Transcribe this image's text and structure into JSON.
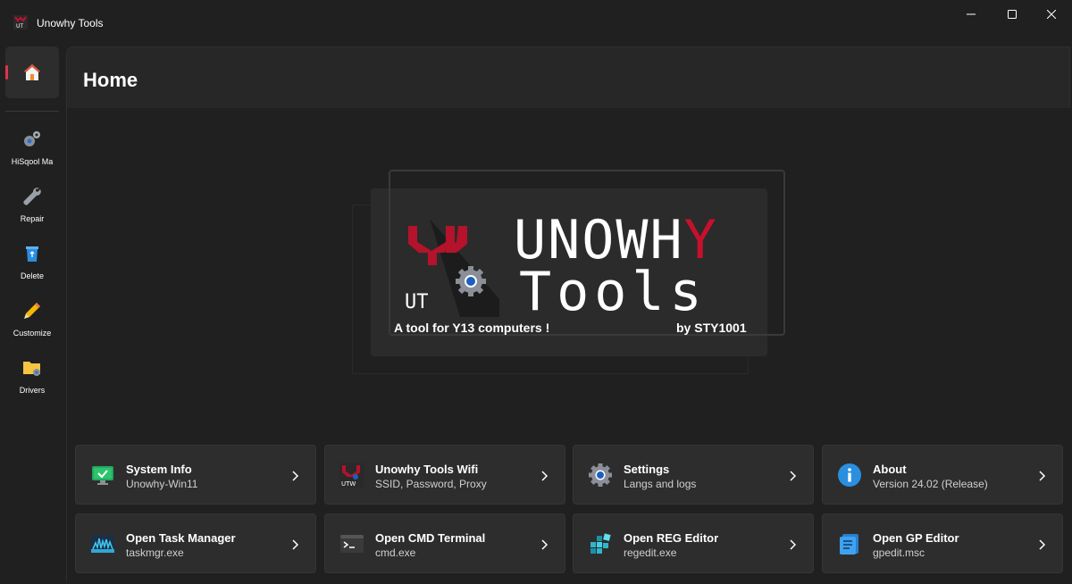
{
  "window": {
    "title": "Unowhy Tools"
  },
  "sidebar": {
    "home_label": "Home",
    "items": [
      {
        "label": "HiSqool Ma",
        "icon": "gears-icon"
      },
      {
        "label": "Repair",
        "icon": "wrench-icon"
      },
      {
        "label": "Delete",
        "icon": "recycle-bin-icon"
      },
      {
        "label": "Customize",
        "icon": "pencil-icon"
      },
      {
        "label": "Drivers",
        "icon": "folder-gear-icon"
      }
    ]
  },
  "page": {
    "title": "Home"
  },
  "banner": {
    "logo_text": "UT",
    "word1_main": "UNOWH",
    "word1_accent": "Y",
    "word2": "Tools",
    "tagline": "A tool for Y13 computers !",
    "credit": "by STY1001",
    "accent_color": "#c8102e"
  },
  "cards": [
    {
      "title": "System Info",
      "subtitle": "Unowhy-Win11",
      "icon": "monitor-check-icon"
    },
    {
      "title": "Unowhy Tools Wifi",
      "subtitle": "SSID, Password, Proxy",
      "icon": "utw-wifi-icon",
      "icon_text": "UTW"
    },
    {
      "title": "Settings",
      "subtitle": "Langs and logs",
      "icon": "settings-gear-icon"
    },
    {
      "title": "About",
      "subtitle": "Version 24.02 (Release)",
      "icon": "info-icon"
    },
    {
      "title": "Open Task Manager",
      "subtitle": "taskmgr.exe",
      "icon": "task-manager-icon"
    },
    {
      "title": "Open CMD Terminal",
      "subtitle": "cmd.exe",
      "icon": "terminal-icon"
    },
    {
      "title": "Open REG Editor",
      "subtitle": "regedit.exe",
      "icon": "registry-icon"
    },
    {
      "title": "Open GP Editor",
      "subtitle": "gpedit.msc",
      "icon": "group-policy-icon"
    }
  ]
}
